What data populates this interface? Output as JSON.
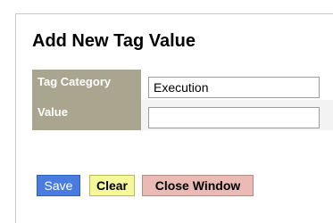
{
  "dialog": {
    "title": "Add New Tag Value"
  },
  "form": {
    "tag_category_label": "Tag Category",
    "tag_category_value": "Execution",
    "value_label": "Value",
    "value_value": ""
  },
  "buttons": {
    "save_label": "Save",
    "clear_label": "Clear",
    "close_label": "Close Window"
  },
  "colors": {
    "label_background": "#a9a58f",
    "save_background": "#4a7ce0",
    "clear_background": "#f4f79a",
    "close_background": "#eabbb4"
  }
}
